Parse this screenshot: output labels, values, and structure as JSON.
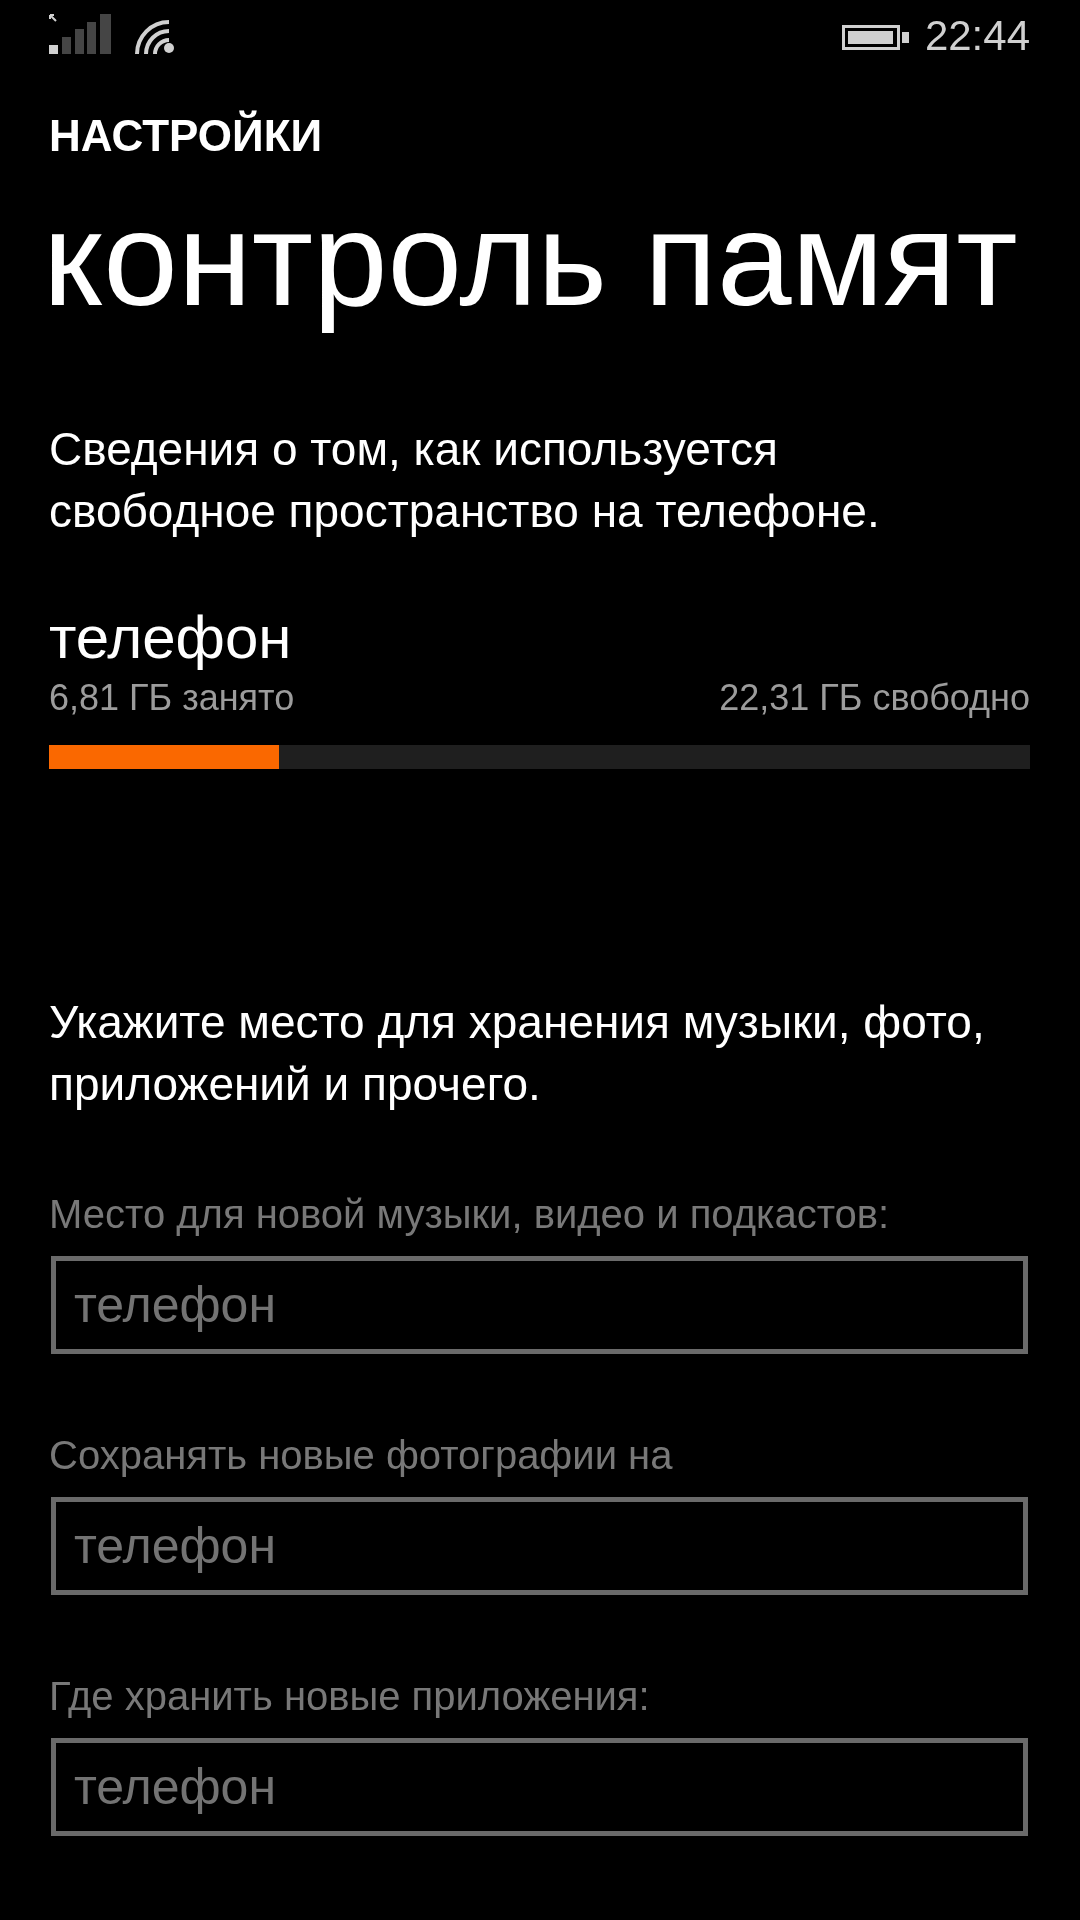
{
  "status_bar": {
    "time": "22:44"
  },
  "header": {
    "app_title": "НАСТРОЙКИ",
    "page_title": "контроль памят"
  },
  "intro": "Сведения о том, как используется свободное пространство на телефоне.",
  "storage": {
    "name": "телефон",
    "used": "6,81 ГБ занято",
    "free": "22,31 ГБ свободно",
    "level": 0.234
  },
  "locations_intro": "Укажите место для хранения музыки, фото, приложений и прочего.",
  "locations": [
    {
      "label": "Место для новой музыки, видео и подкастов:",
      "value": "телефон",
      "disabled": true
    },
    {
      "label": "Сохранять новые фотографии на",
      "value": "телефон",
      "disabled": true
    },
    {
      "label": "Где хранить новые приложения:",
      "value": "телефон",
      "disabled": true
    }
  ]
}
